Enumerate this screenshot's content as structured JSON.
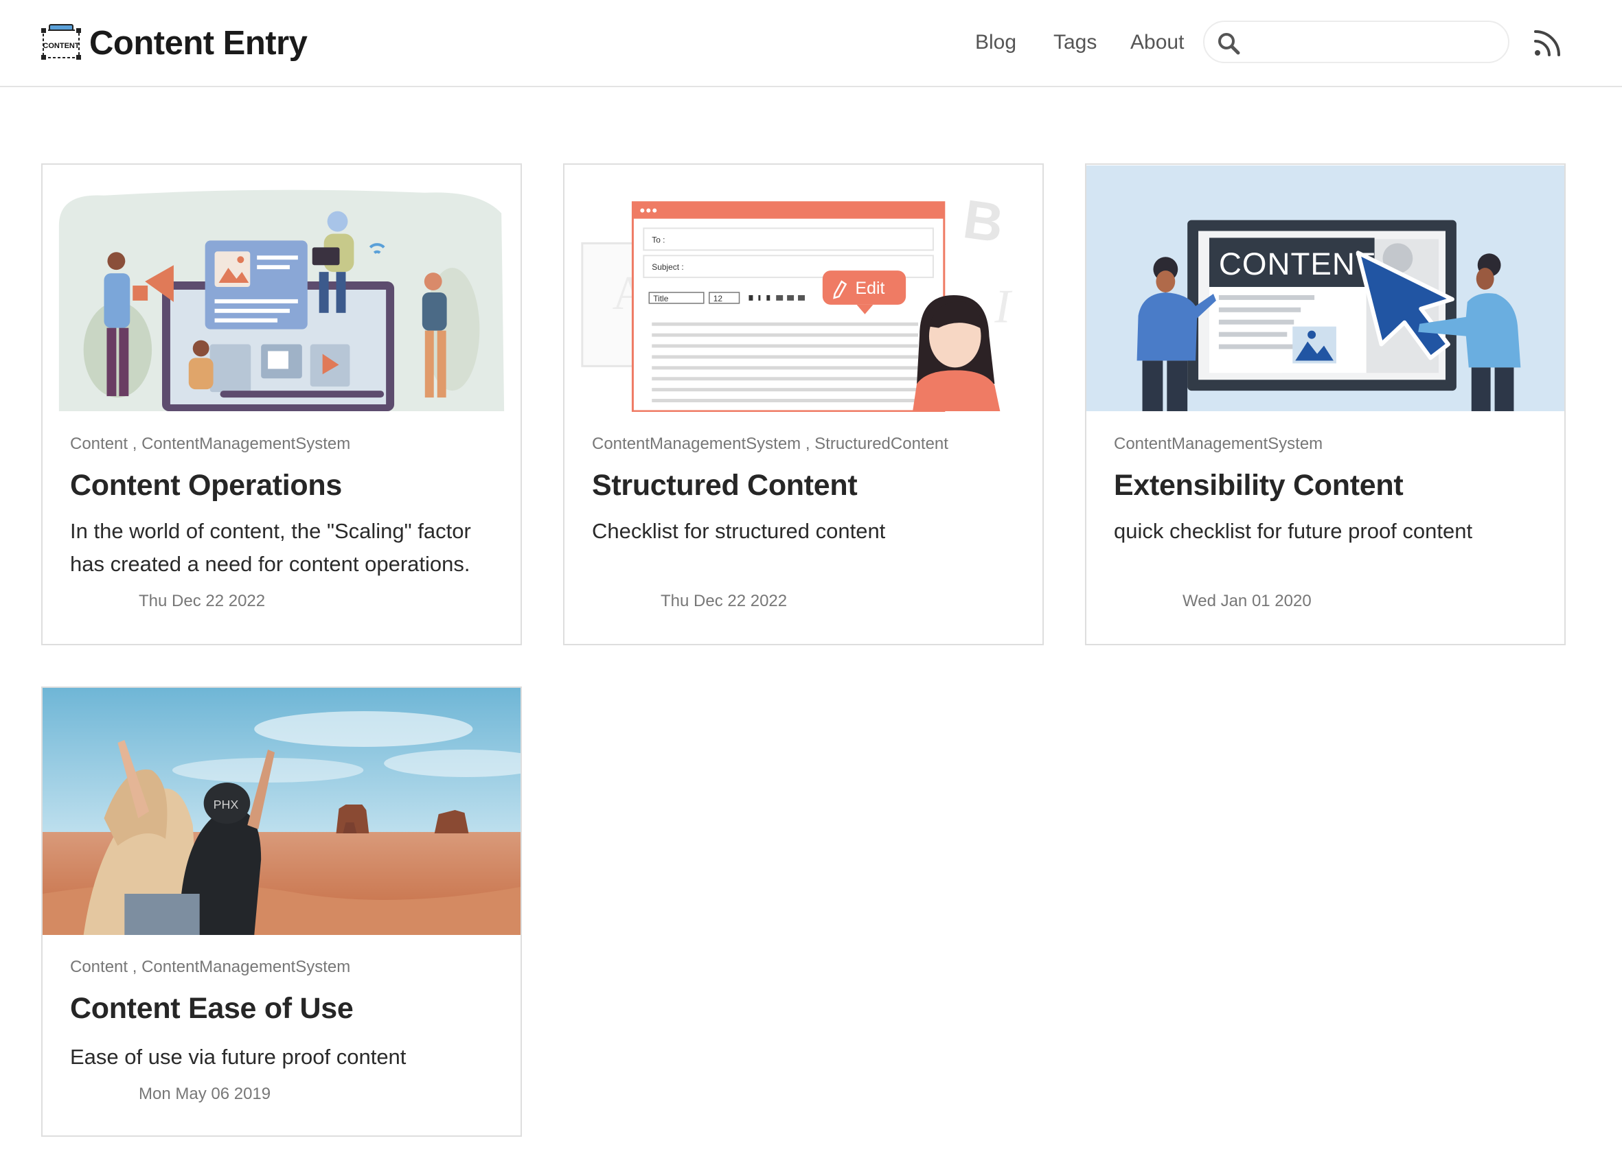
{
  "header": {
    "brand": "Content Entry",
    "logo_text": "CONTENT",
    "nav": [
      "Blog",
      "Tags",
      "About"
    ],
    "search": {
      "placeholder": "",
      "value": "",
      "icon": "search-icon"
    },
    "rss_icon": "rss-icon"
  },
  "posts": [
    {
      "tags": "Content , ContentManagementSystem",
      "title": "Content Operations",
      "description": "In the world of content, the \"Scaling\" factor has created a need for content operations.",
      "date": "Thu Dec 22 2022",
      "image": "content-operations-illustration"
    },
    {
      "tags": "ContentManagementSystem , StructuredContent",
      "title": "Structured Content",
      "description": "Checklist for structured content",
      "date": "Thu Dec 22 2022",
      "image": "structured-content-illustration",
      "image_text": {
        "to": "To :",
        "subject": "Subject :",
        "format": "Title",
        "size": "12",
        "edit": "Edit",
        "letters": [
          "A",
          "B",
          "I"
        ]
      }
    },
    {
      "tags": "ContentManagementSystem",
      "title": "Extensibility Content",
      "description": "quick checklist for future proof content",
      "date": "Wed Jan 01 2020",
      "image": "extensibility-content-illustration",
      "image_text": {
        "banner": "CONTENT"
      }
    },
    {
      "tags": "Content , ContentManagementSystem",
      "title": "Content Ease of Use",
      "description": "Ease of use via future proof content",
      "date": "Mon May 06 2019",
      "image": "desert-photo",
      "image_text": {
        "cap": "PHX"
      }
    }
  ],
  "colors": {
    "accent_red": "#ef7b64",
    "accent_blue": "#2155a3",
    "light_blue": "#d4e5f3",
    "text_dark": "#262626",
    "text_muted": "#777777"
  }
}
